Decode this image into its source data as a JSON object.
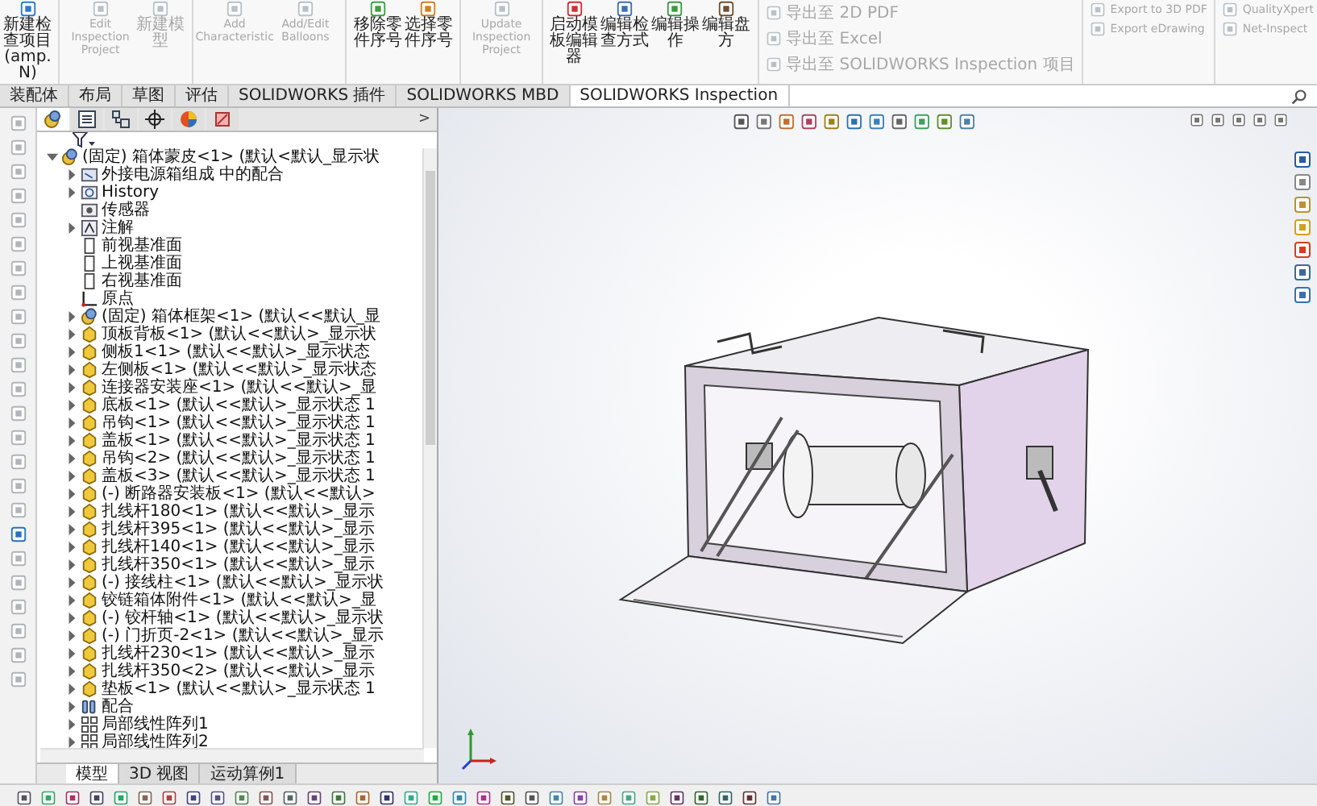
{
  "ribbon": {
    "buttons": [
      {
        "label": "新建检查项目(amp.N)",
        "kind": "cjk",
        "disabled": false
      },
      {
        "label": "Edit Inspection Project",
        "kind": "latin",
        "disabled": true
      },
      {
        "label": "新建模型",
        "kind": "cjk",
        "disabled": true
      },
      {
        "label": "Add Characteristic",
        "kind": "latin",
        "disabled": true
      },
      {
        "label": "Add/Edit Balloons",
        "kind": "latin",
        "disabled": true
      },
      {
        "label": "移除零件序号",
        "kind": "cjk",
        "disabled": false
      },
      {
        "label": "选择零件序号",
        "kind": "cjk",
        "disabled": false
      },
      {
        "label": "Update Inspection Project",
        "kind": "latin",
        "disabled": true
      },
      {
        "label": "启动模板编辑器",
        "kind": "cjk",
        "disabled": false
      },
      {
        "label": "编辑检查方式",
        "kind": "cjk",
        "disabled": false
      },
      {
        "label": "编辑操作",
        "kind": "cjk",
        "disabled": false
      },
      {
        "label": "编辑盘方",
        "kind": "cjk",
        "disabled": false
      }
    ],
    "small_columns": [
      [
        {
          "label": "导出至 2D PDF",
          "kind": "cjk",
          "disabled": true
        },
        {
          "label": "导出至 Excel",
          "kind": "cjk",
          "disabled": true
        },
        {
          "label": "导出至 SOLIDWORKS Inspection 项目",
          "kind": "cjk",
          "disabled": true
        }
      ],
      [
        {
          "label": "Export to 3D PDF",
          "kind": "latin",
          "disabled": true
        },
        {
          "label": "Export eDrawing",
          "kind": "latin",
          "disabled": true
        }
      ],
      [
        {
          "label": "QualityXpert",
          "kind": "latin",
          "disabled": true
        },
        {
          "label": "Net-Inspect",
          "kind": "latin",
          "disabled": true
        }
      ]
    ]
  },
  "tabs": [
    {
      "label": "装配体",
      "selected": false
    },
    {
      "label": "布局",
      "selected": false
    },
    {
      "label": "草图",
      "selected": false
    },
    {
      "label": "评估",
      "selected": false
    },
    {
      "label": "SOLIDWORKS 插件",
      "selected": false
    },
    {
      "label": "SOLIDWORKS MBD",
      "selected": false
    },
    {
      "label": "SOLIDWORKS Inspection",
      "selected": true
    }
  ],
  "panel": {
    "tabs": [
      {
        "kind": "feature-tree",
        "selected": true
      },
      {
        "kind": "property",
        "selected": false
      },
      {
        "kind": "config",
        "selected": false
      },
      {
        "kind": "dimxpert",
        "selected": false
      },
      {
        "kind": "display",
        "selected": false
      },
      {
        "kind": "cam",
        "selected": false
      }
    ],
    "more": ">",
    "feature_tree": {
      "items": [
        {
          "label": "(固定) 箱体蒙皮<1> (默认<默认_显示状",
          "kind": "assembly",
          "expandable": true,
          "expanded": true,
          "children": [
            {
              "label": "外接电源箱组成 中的配合",
              "kind": "mates-folder",
              "expandable": true,
              "expanded": false
            },
            {
              "label": "History",
              "kind": "history",
              "expandable": true,
              "expanded": false
            },
            {
              "label": "传感器",
              "kind": "sensor",
              "expandable": false
            },
            {
              "label": "注解",
              "kind": "annotation",
              "expandable": true,
              "expanded": false
            },
            {
              "label": "前视基准面",
              "kind": "plane",
              "expandable": false
            },
            {
              "label": "上视基准面",
              "kind": "plane",
              "expandable": false
            },
            {
              "label": "右视基准面",
              "kind": "plane",
              "expandable": false
            },
            {
              "label": "原点",
              "kind": "origin",
              "expandable": false
            },
            {
              "label": "(固定) 箱体框架<1> (默认<<默认_显",
              "kind": "assembly",
              "expandable": true,
              "expanded": false
            },
            {
              "label": "顶板背板<1> (默认<<默认>_显示状",
              "kind": "part",
              "expandable": true,
              "expanded": false
            },
            {
              "label": "侧板1<1> (默认<<默认>_显示状态",
              "kind": "part",
              "expandable": true,
              "expanded": false
            },
            {
              "label": "左侧板<1> (默认<<默认>_显示状态",
              "kind": "part",
              "expandable": true,
              "expanded": false
            },
            {
              "label": "连接器安装座<1> (默认<<默认>_显",
              "kind": "part",
              "expandable": true,
              "expanded": false
            },
            {
              "label": "底板<1> (默认<<默认>_显示状态 1",
              "kind": "part",
              "expandable": true,
              "expanded": false
            },
            {
              "label": "吊钩<1> (默认<<默认>_显示状态 1",
              "kind": "part",
              "expandable": true,
              "expanded": false
            },
            {
              "label": "盖板<1> (默认<<默认>_显示状态 1",
              "kind": "part",
              "expandable": true,
              "expanded": false
            },
            {
              "label": "吊钩<2> (默认<<默认>_显示状态 1",
              "kind": "part",
              "expandable": true,
              "expanded": false
            },
            {
              "label": "盖板<3> (默认<<默认>_显示状态 1",
              "kind": "part",
              "expandable": true,
              "expanded": false
            },
            {
              "label": "(-) 断路器安装板<1> (默认<<默认>",
              "kind": "part",
              "expandable": true,
              "expanded": false
            },
            {
              "label": "扎线杆180<1> (默认<<默认>_显示",
              "kind": "part",
              "expandable": true,
              "expanded": false
            },
            {
              "label": "扎线杆395<1> (默认<<默认>_显示",
              "kind": "part",
              "expandable": true,
              "expanded": false
            },
            {
              "label": "扎线杆140<1> (默认<<默认>_显示",
              "kind": "part",
              "expandable": true,
              "expanded": false
            },
            {
              "label": "扎线杆350<1> (默认<<默认>_显示",
              "kind": "part",
              "expandable": true,
              "expanded": false
            },
            {
              "label": "(-) 接线柱<1> (默认<<默认>_显示状",
              "kind": "part",
              "expandable": true,
              "expanded": false
            },
            {
              "label": "铰链箱体附件<1> (默认<<默认>_显",
              "kind": "part",
              "expandable": true,
              "expanded": false
            },
            {
              "label": "(-) 铰杆轴<1> (默认<<默认>_显示状",
              "kind": "part",
              "expandable": true,
              "expanded": false
            },
            {
              "label": "(-) 门折页-2<1> (默认<<默认>_显示",
              "kind": "part",
              "expandable": true,
              "expanded": false
            },
            {
              "label": "扎线杆230<1> (默认<<默认>_显示",
              "kind": "part",
              "expandable": true,
              "expanded": false
            },
            {
              "label": "扎线杆350<2> (默认<<默认>_显示",
              "kind": "part",
              "expandable": true,
              "expanded": false
            },
            {
              "label": "垫板<1> (默认<<默认>_显示状态 1",
              "kind": "part",
              "expandable": true,
              "expanded": false
            },
            {
              "label": "配合",
              "kind": "mates",
              "expandable": true,
              "expanded": false
            },
            {
              "label": "局部线性阵列1",
              "kind": "pattern",
              "expandable": true,
              "expanded": false
            },
            {
              "label": "局部线性阵列2",
              "kind": "pattern",
              "expandable": true,
              "expanded": false
            }
          ]
        }
      ]
    },
    "bottom_tabs": [
      {
        "label": "模型",
        "selected": true
      },
      {
        "label": "3D 视图",
        "selected": false
      },
      {
        "label": "运动算例1",
        "selected": false
      }
    ]
  }
}
